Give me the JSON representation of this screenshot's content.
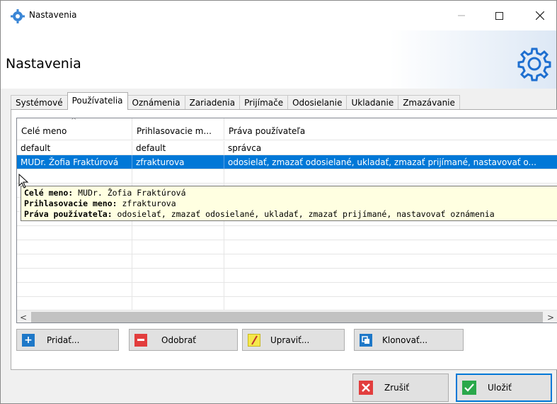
{
  "window": {
    "title": "Nastavenia"
  },
  "header": {
    "title": "Nastavenia"
  },
  "tabs": [
    {
      "label": "Systémové",
      "active": false
    },
    {
      "label": "Používatelia",
      "active": true
    },
    {
      "label": "Oznámenia",
      "active": false
    },
    {
      "label": "Zariadenia",
      "active": false
    },
    {
      "label": "Prijímače",
      "active": false
    },
    {
      "label": "Odosielanie",
      "active": false
    },
    {
      "label": "Ukladanie",
      "active": false
    },
    {
      "label": "Zmazávanie",
      "active": false
    }
  ],
  "grid": {
    "columns": [
      "Celé meno",
      "Prihlasovacie m...",
      "Práva používateľa"
    ],
    "rows": [
      {
        "name": "default",
        "login": "default",
        "rights": "správca",
        "selected": false
      },
      {
        "name": "MUDr. Žofia Fraktúrová",
        "login": "zfrakturova",
        "rights": "odosielať, zmazať odosielané, ukladať, zmazať prijímané, nastavovať o...",
        "selected": true
      }
    ]
  },
  "tooltip": {
    "name_label": "Celé meno:",
    "name_value": " MUDr. Žofia Fraktúrová",
    "login_label": "Prihlasovacie meno:",
    "login_value": " zfrakturova",
    "rights_label": "Práva používateľa:",
    "rights_value": " odosielať, zmazať odosielané, ukladať, zmazať prijímané, nastavovať oznámenia"
  },
  "actions": {
    "add": "Pridať...",
    "remove": "Odobrať",
    "edit": "Upraviť...",
    "clone": "Klonovať..."
  },
  "footer": {
    "cancel": "Zrušiť",
    "save": "Uložiť"
  },
  "colors": {
    "selection": "#0078d7",
    "tooltip_bg": "#ffffe1",
    "add_icon": "#1e78c8",
    "remove_icon": "#e23d3d",
    "edit_icon": "#f5e84a",
    "clone_icon": "#1e78c8",
    "cancel_icon": "#e23d3d",
    "save_icon": "#2aa84a"
  }
}
